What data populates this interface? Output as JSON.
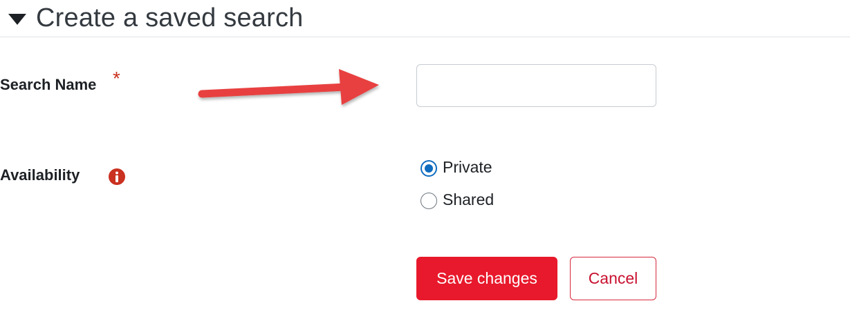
{
  "section": {
    "title": "Create a saved search",
    "toggle_icon": "caret-down-icon"
  },
  "form": {
    "search_name": {
      "label": "Search Name",
      "required_mark": "*",
      "value": "",
      "placeholder": ""
    },
    "availability": {
      "label": "Availability",
      "info_icon": "info-icon",
      "options": [
        {
          "label": "Private",
          "checked": true
        },
        {
          "label": "Shared",
          "checked": false
        }
      ]
    }
  },
  "buttons": {
    "save_label": "Save changes",
    "cancel_label": "Cancel"
  },
  "colors": {
    "primary": "#e8192c",
    "required": "#ca3120",
    "radio_checked": "#0f6cbf",
    "arrow": "#e84040"
  }
}
